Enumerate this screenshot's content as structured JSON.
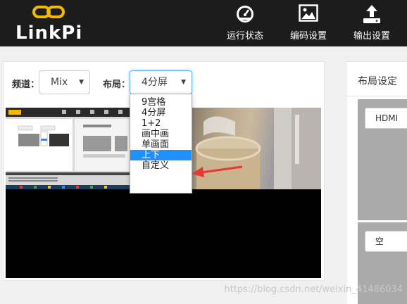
{
  "header": {
    "brand": "LinkPi",
    "nav": [
      {
        "label": "运行状态",
        "icon": "gauge-icon"
      },
      {
        "label": "编码设置",
        "icon": "image-icon"
      },
      {
        "label": "输出设置",
        "icon": "upload-icon"
      }
    ]
  },
  "controls": {
    "channel_label": "频道：",
    "channel_value": "Mix",
    "layout_label": "布局：",
    "layout_value": "4分屏"
  },
  "layout_options": [
    "9宫格",
    "4分屏",
    "1+2",
    "画中画",
    "单画面",
    "上下",
    "自定义"
  ],
  "highlighted_option": "上下",
  "right_panel": {
    "title": "布局设定",
    "source_1": "HDMI",
    "source_2": "空"
  },
  "watermark": "https://blog.csdn.net/weixin_41486034",
  "colors": {
    "header_bg": "#1c1c1c",
    "logo_accent": "#f5b800",
    "highlight": "#1e90ff",
    "arrow": "#e53935"
  }
}
